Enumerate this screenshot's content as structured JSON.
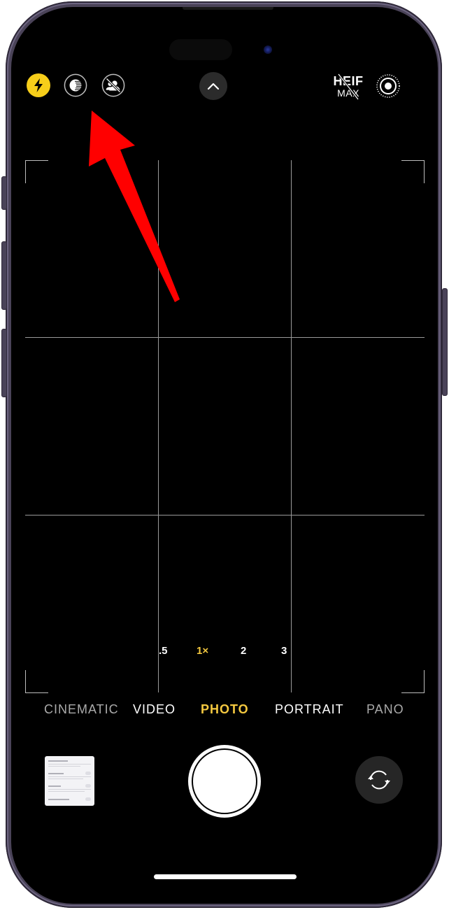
{
  "device": {
    "model": "iPhone",
    "frame_color": "#4a4358"
  },
  "camera": {
    "top_bar": {
      "flash": {
        "icon": "flash-icon",
        "state": "auto",
        "color": "#f7ce1a"
      },
      "night_mode": {
        "icon": "night-mode-icon",
        "state": "off"
      },
      "live_photo_top": {
        "icon": "portrait-off-icon",
        "state": "off"
      },
      "expand_controls": {
        "icon": "chevron-up-icon"
      },
      "format": {
        "heif_label": "HEIF",
        "max_label": "MAX",
        "state": "off"
      },
      "live_photo": {
        "icon": "live-photo-icon",
        "state": "on"
      }
    },
    "zoom_levels": [
      {
        "label": ".5",
        "active": false
      },
      {
        "label": "1×",
        "active": true
      },
      {
        "label": "2",
        "active": false
      },
      {
        "label": "3",
        "active": false
      }
    ],
    "modes": [
      {
        "label": "CINEMATIC",
        "active": false
      },
      {
        "label": "VIDEO",
        "active": false
      },
      {
        "label": "PHOTO",
        "active": true
      },
      {
        "label": "PORTRAIT",
        "active": false
      },
      {
        "label": "PANO",
        "active": false
      }
    ],
    "accent_color": "#f5c940",
    "bottom_bar": {
      "thumbnail": {
        "icon": "last-photo-thumbnail"
      },
      "shutter": {
        "icon": "shutter-button"
      },
      "flip": {
        "icon": "camera-flip-icon"
      }
    }
  },
  "annotation": {
    "type": "arrow",
    "color": "#ff0000",
    "points_to": "night-mode-button"
  }
}
